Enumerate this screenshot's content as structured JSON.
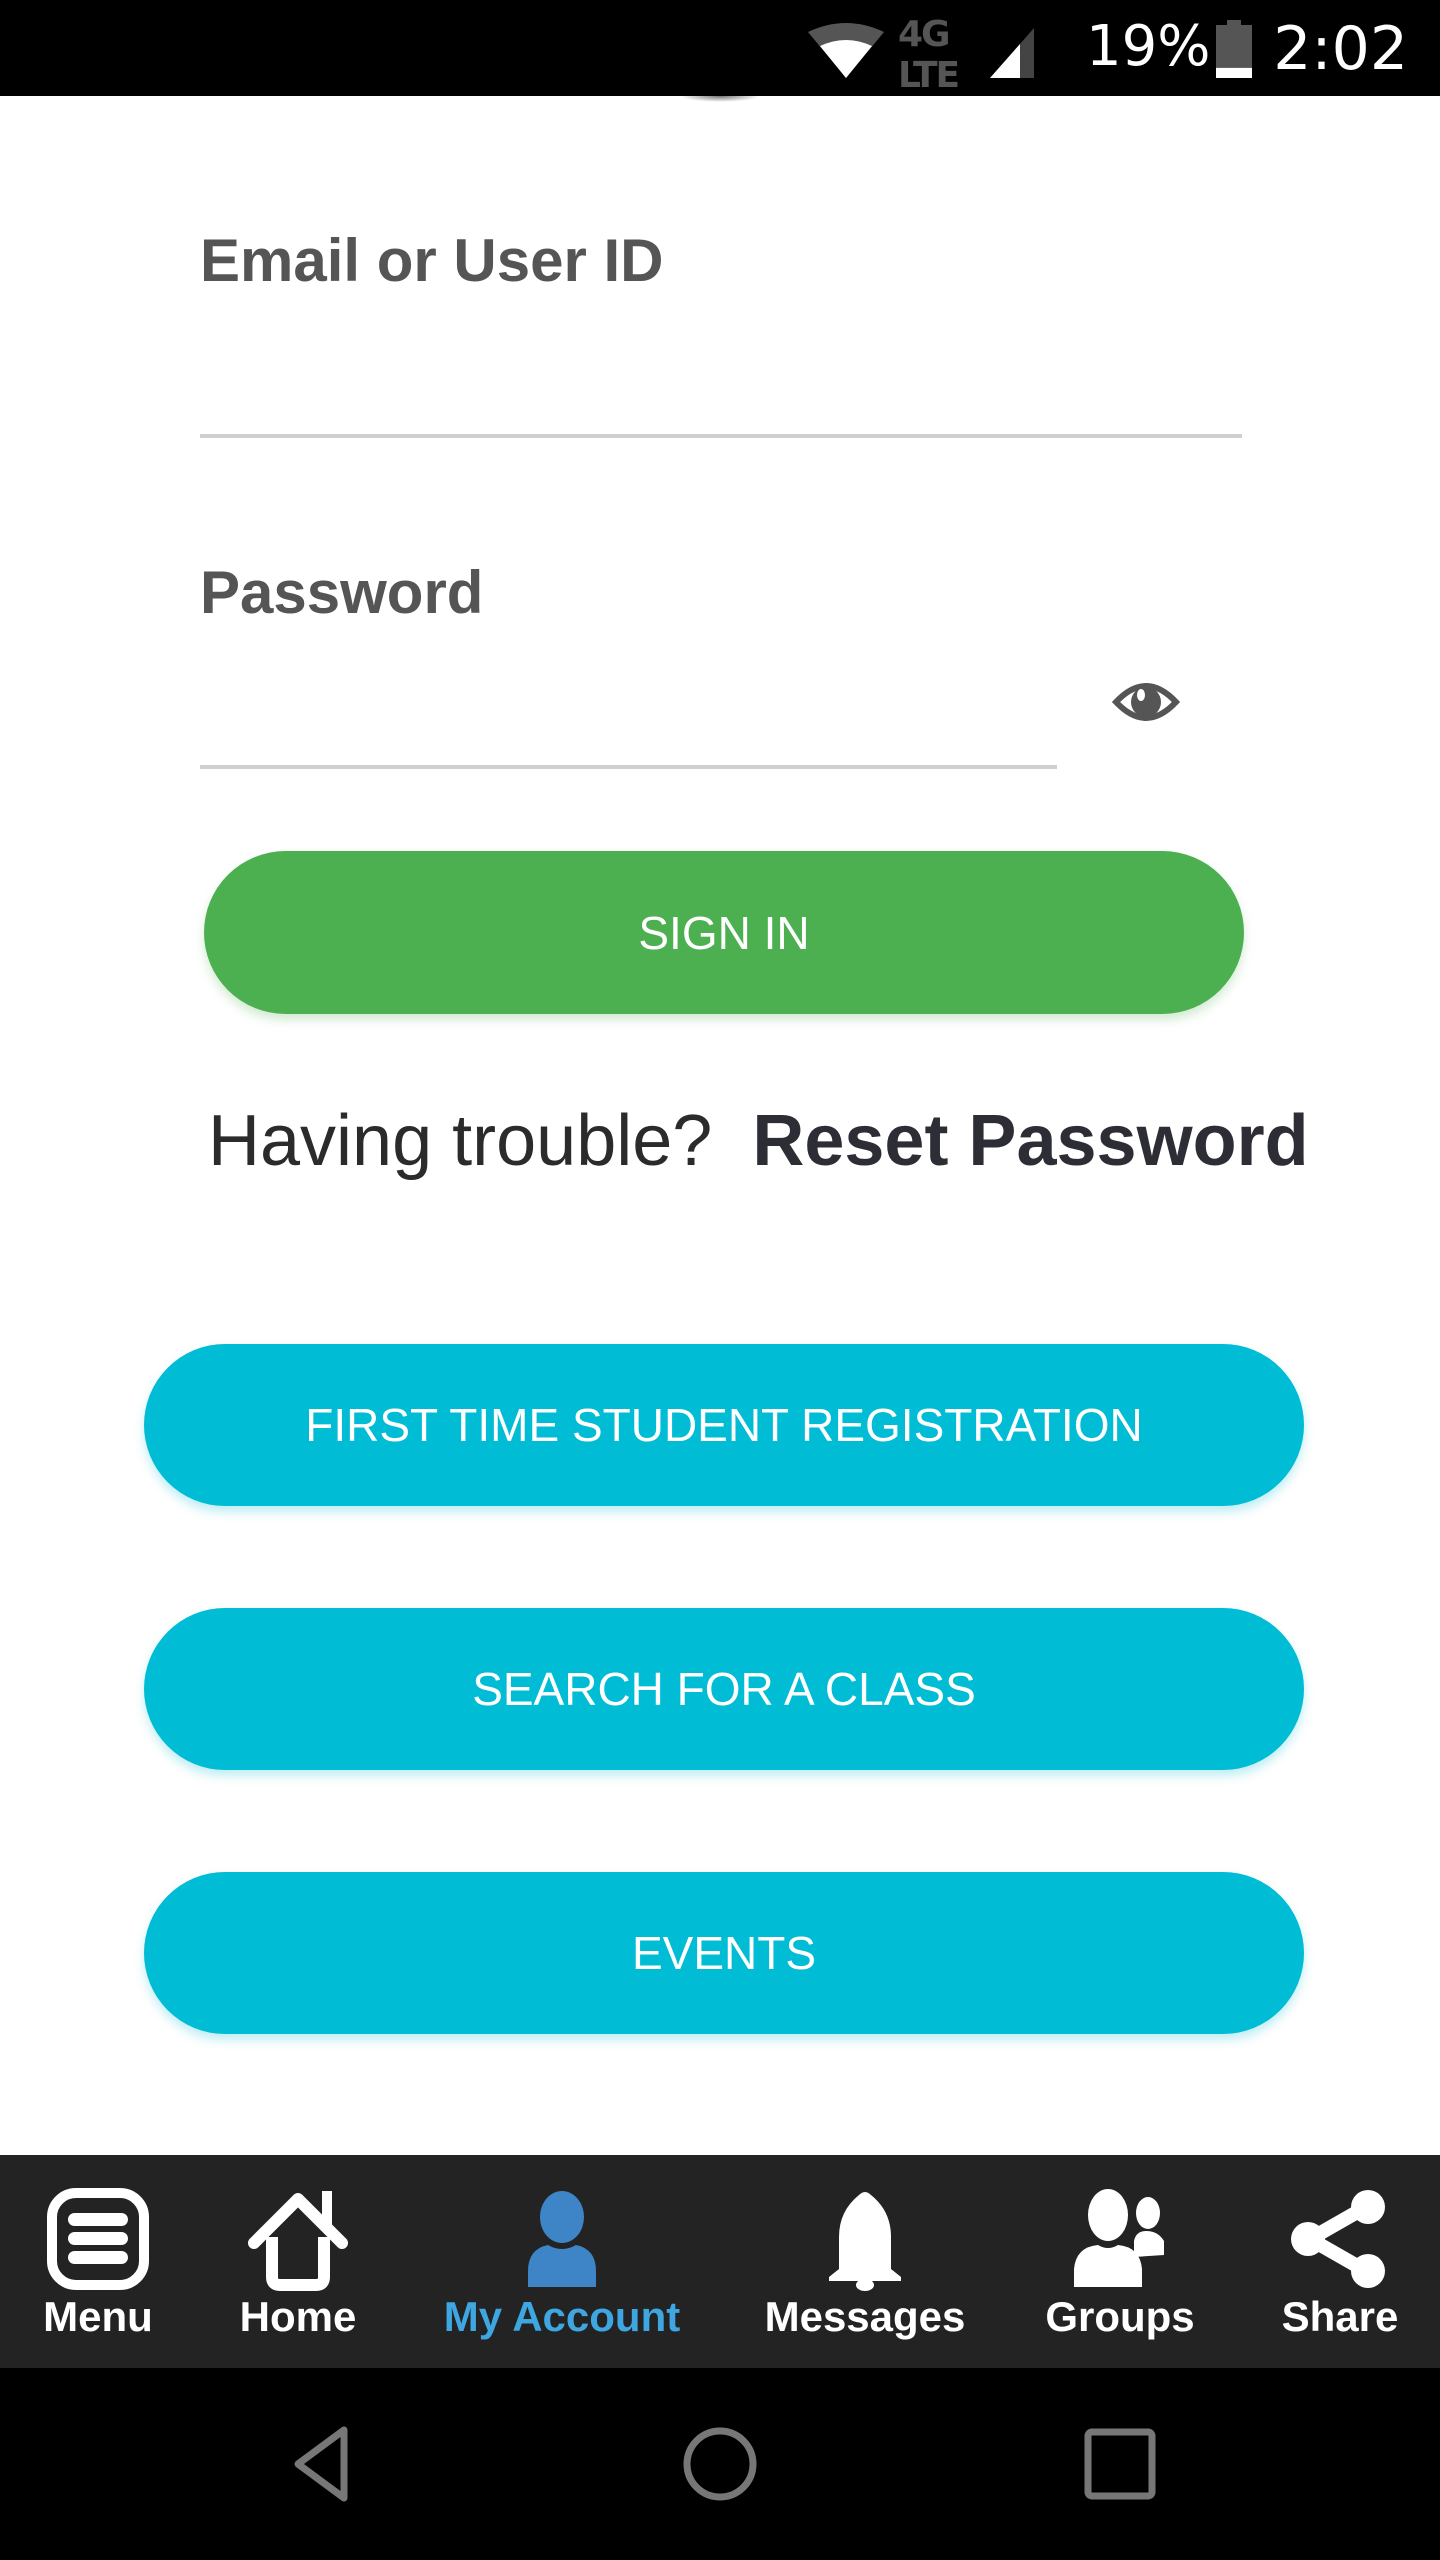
{
  "status_bar": {
    "network": "4G LTE",
    "battery_percent": "19%",
    "battery_level": 0.19,
    "time": "2:02"
  },
  "login_form": {
    "email": {
      "label": "Email or User ID",
      "value": "",
      "placeholder": ""
    },
    "password": {
      "label": "Password",
      "value": "",
      "placeholder": "",
      "toggle_icon": "eye-icon"
    },
    "sign_in_label": "SIGN IN",
    "trouble_text": "Having trouble?",
    "reset_password_label": "Reset Password"
  },
  "actions": [
    {
      "label": "FIRST TIME STUDENT REGISTRATION"
    },
    {
      "label": "SEARCH FOR A CLASS"
    },
    {
      "label": "EVENTS"
    }
  ],
  "tab_bar": {
    "active_index": 2,
    "items": [
      {
        "label": "Menu",
        "icon": "menu-icon"
      },
      {
        "label": "Home",
        "icon": "home-icon"
      },
      {
        "label": "My Account",
        "icon": "user-icon"
      },
      {
        "label": "Messages",
        "icon": "bell-icon"
      },
      {
        "label": "Groups",
        "icon": "groups-icon"
      },
      {
        "label": "Share",
        "icon": "share-icon"
      }
    ]
  },
  "system_nav": {
    "buttons": [
      "back",
      "home",
      "recents"
    ]
  },
  "colors": {
    "sign_in": "#4caf50",
    "action_buttons": "#00bcd4",
    "active_tab": "#3ea6e0",
    "tab_bar_bg": "#232323"
  }
}
